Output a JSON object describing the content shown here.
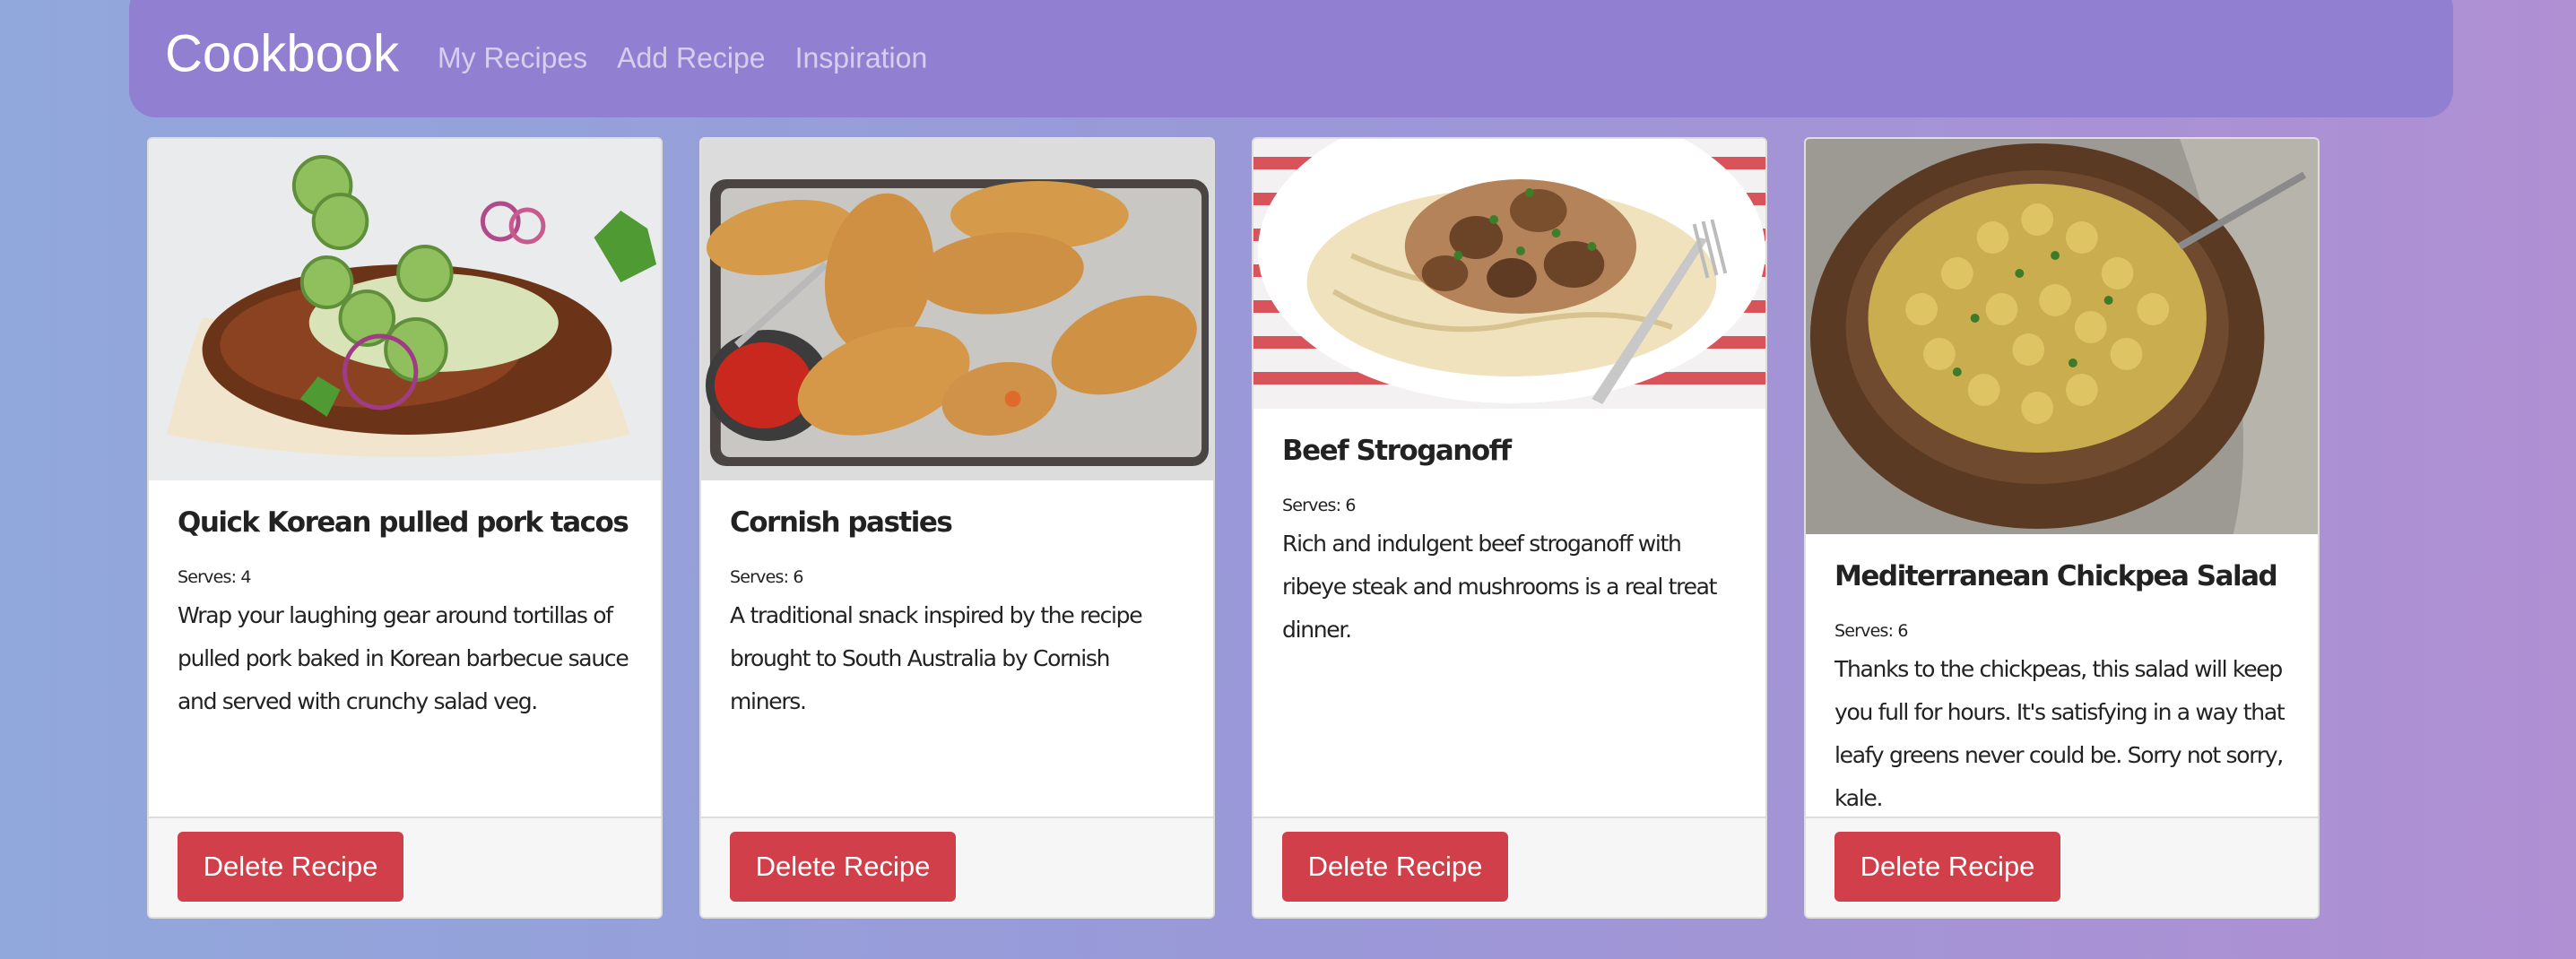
{
  "navbar": {
    "brand": "Cookbook",
    "links": [
      "My Recipes",
      "Add Recipe",
      "Inspiration"
    ]
  },
  "recipes": [
    {
      "title": "Quick Korean pulled pork tacos",
      "serves_label": "Serves: 4",
      "description": "Wrap your laughing gear around tortillas of pulled pork baked in Korean barbecue sauce and served with crunchy salad veg.",
      "delete_label": "Delete Recipe"
    },
    {
      "title": "Cornish pasties",
      "serves_label": "Serves: 6",
      "description": "A traditional snack inspired by the recipe brought to South Australia by Cornish miners.",
      "delete_label": "Delete Recipe"
    },
    {
      "title": "Beef Stroganoff",
      "serves_label": "Serves: 6",
      "description": "Rich and indulgent beef stroganoff with ribeye steak and mushrooms is a real treat dinner.",
      "delete_label": "Delete Recipe"
    },
    {
      "title": "Mediterranean Chickpea Salad",
      "serves_label": "Serves: 6",
      "description": "Thanks to the chickpeas, this salad will keep you full for hours. It's satisfying in a way that leafy greens never could be. Sorry not sorry, kale.",
      "delete_label": "Delete Recipe"
    }
  ],
  "colors": {
    "navbar": "#9180d2",
    "delete_button": "#d1404a"
  }
}
